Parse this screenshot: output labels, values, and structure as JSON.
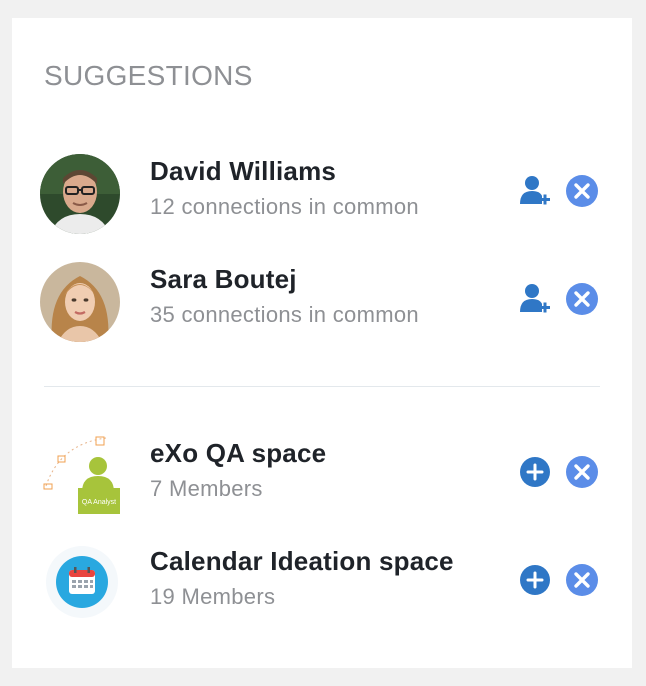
{
  "section_title": "SUGGESTIONS",
  "people": [
    {
      "name": "David Williams",
      "subtitle": "12 connections in common"
    },
    {
      "name": "Sara Boutej",
      "subtitle": "35 connections in common"
    }
  ],
  "spaces": [
    {
      "name": "eXo QA space",
      "subtitle": "7 Members",
      "badge": "QA Analyst"
    },
    {
      "name": "Calendar Ideation space",
      "subtitle": "19 Members"
    }
  ],
  "colors": {
    "accent": "#2f77c6",
    "dismiss": "#5b8de8",
    "title": "#8e9094",
    "name": "#1f2329"
  },
  "icons": [
    "add-user-icon",
    "dismiss-icon",
    "join-space-icon",
    "calendar-icon"
  ]
}
